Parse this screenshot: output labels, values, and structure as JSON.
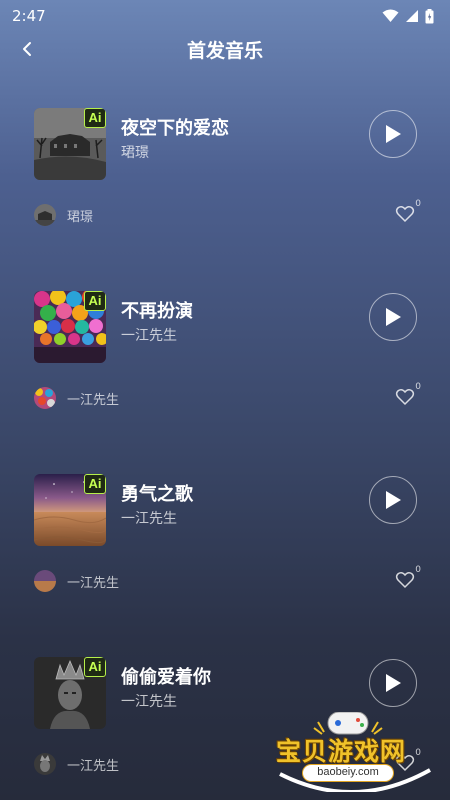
{
  "status": {
    "time": "2:47"
  },
  "header": {
    "title": "首发音乐"
  },
  "songs": [
    {
      "title": "夜空下的爱恋",
      "artist": "珺璟",
      "author": "珺璟",
      "likes": "0",
      "ai_badge": "Ai"
    },
    {
      "title": "不再扮演",
      "artist": "一江先生",
      "author": "一江先生",
      "likes": "0",
      "ai_badge": "Ai"
    },
    {
      "title": "勇气之歌",
      "artist": "一江先生",
      "author": "一江先生",
      "likes": "0",
      "ai_badge": "Ai"
    },
    {
      "title": "偷偷爱着你",
      "artist": "一江先生",
      "author": "一江先生",
      "likes": "0",
      "ai_badge": "Ai"
    }
  ],
  "watermark": {
    "brand": "宝贝游戏网",
    "url": "baobeiy.com"
  },
  "icons": {
    "back": "back-arrow-icon",
    "play": "play-icon",
    "like": "heart-icon",
    "wifi": "wifi-icon",
    "signal": "signal-icon",
    "battery": "battery-icon"
  },
  "colors": {
    "badge_text": "#c6ff52",
    "watermark_text": "#f0c22a"
  }
}
